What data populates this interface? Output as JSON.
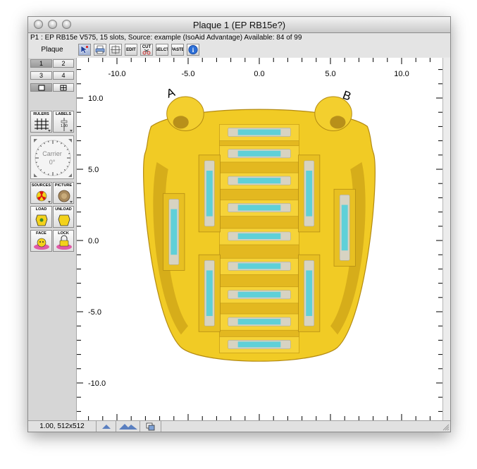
{
  "window": {
    "title": "Plaque 1 (EP RB15e?)",
    "info": "P1 : EP RB15e V575, 15 slots, Source: example (IsoAid Advantage) Available: 84 of 99"
  },
  "toolbar": {
    "label": "Plaque",
    "buttons": [
      {
        "id": "arrow",
        "icon": "pointer-icon",
        "text": ""
      },
      {
        "id": "print",
        "icon": "print-icon",
        "text": ""
      },
      {
        "id": "align",
        "icon": "align-icon",
        "text": ""
      },
      {
        "id": "edit",
        "icon": "",
        "text": "EDIT"
      },
      {
        "id": "cut",
        "icon": "scissors-icon",
        "text": "CUT"
      },
      {
        "id": "select",
        "icon": "",
        "text": "SELCT"
      },
      {
        "id": "paste",
        "icon": "",
        "text": "PASTE"
      },
      {
        "id": "info",
        "icon": "info-icon",
        "text": "i"
      }
    ]
  },
  "palette": {
    "view_buttons": [
      "1",
      "2",
      "3",
      "4"
    ],
    "rulers_label": "RULERS",
    "labels_label": "LABELS",
    "labels_scale": "1.00",
    "dial_label": "Carrier",
    "dial_value": "0°",
    "sources_label": "SOURCES",
    "picture_label": "PICTURE",
    "load_label": "LOAD",
    "unload_label": "UNLOAD",
    "face_label": "FACE",
    "lock_label": "LOCK"
  },
  "canvas": {
    "x_ticks": [
      "-10.0",
      "-5.0",
      "0.0",
      "5.0",
      "10.0"
    ],
    "y_ticks": [
      "10.0",
      "5.0",
      "0.0",
      "-5.0",
      "-10.0"
    ],
    "marker_a": "A",
    "marker_b": "B",
    "plaque_color": "#f1cb25",
    "seed_color": "#5fd0d8"
  },
  "status": {
    "zoom": "1.00, 512x512"
  }
}
